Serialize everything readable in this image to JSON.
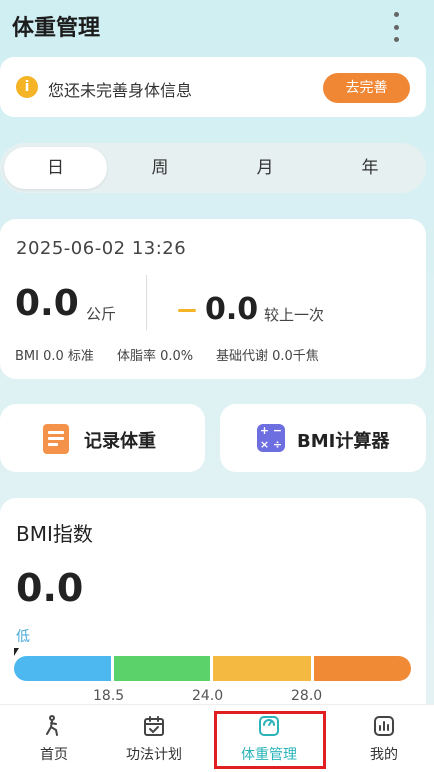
{
  "header": {
    "title": "体重管理"
  },
  "notice": {
    "text": "您还未完善身体信息",
    "button": "去完善"
  },
  "tabs": [
    "日",
    "周",
    "月",
    "年"
  ],
  "weight_card": {
    "datetime": "2025-06-02 13:26",
    "weight": "0.0",
    "weight_unit": "公斤",
    "change": "0.0",
    "change_label": "较上一次",
    "bmi": "BMI 0.0 标准",
    "body_fat": "体脂率 0.0%",
    "bmr": "基础代谢 0.0千焦"
  },
  "actions": {
    "record_weight": "记录体重",
    "bmi_calculator": "BMI计算器"
  },
  "bmi_card": {
    "title": "BMI指数",
    "value": "0.0",
    "level": "低",
    "thresholds": [
      "18.5",
      "24.0",
      "28.0"
    ],
    "colors": [
      "#4db8f0",
      "#5cd36a",
      "#f4b940",
      "#f08a34"
    ]
  },
  "bottom_nav": {
    "items": [
      "首页",
      "功法计划",
      "体重管理",
      "我的"
    ],
    "active_color": "#2ab3b8"
  }
}
